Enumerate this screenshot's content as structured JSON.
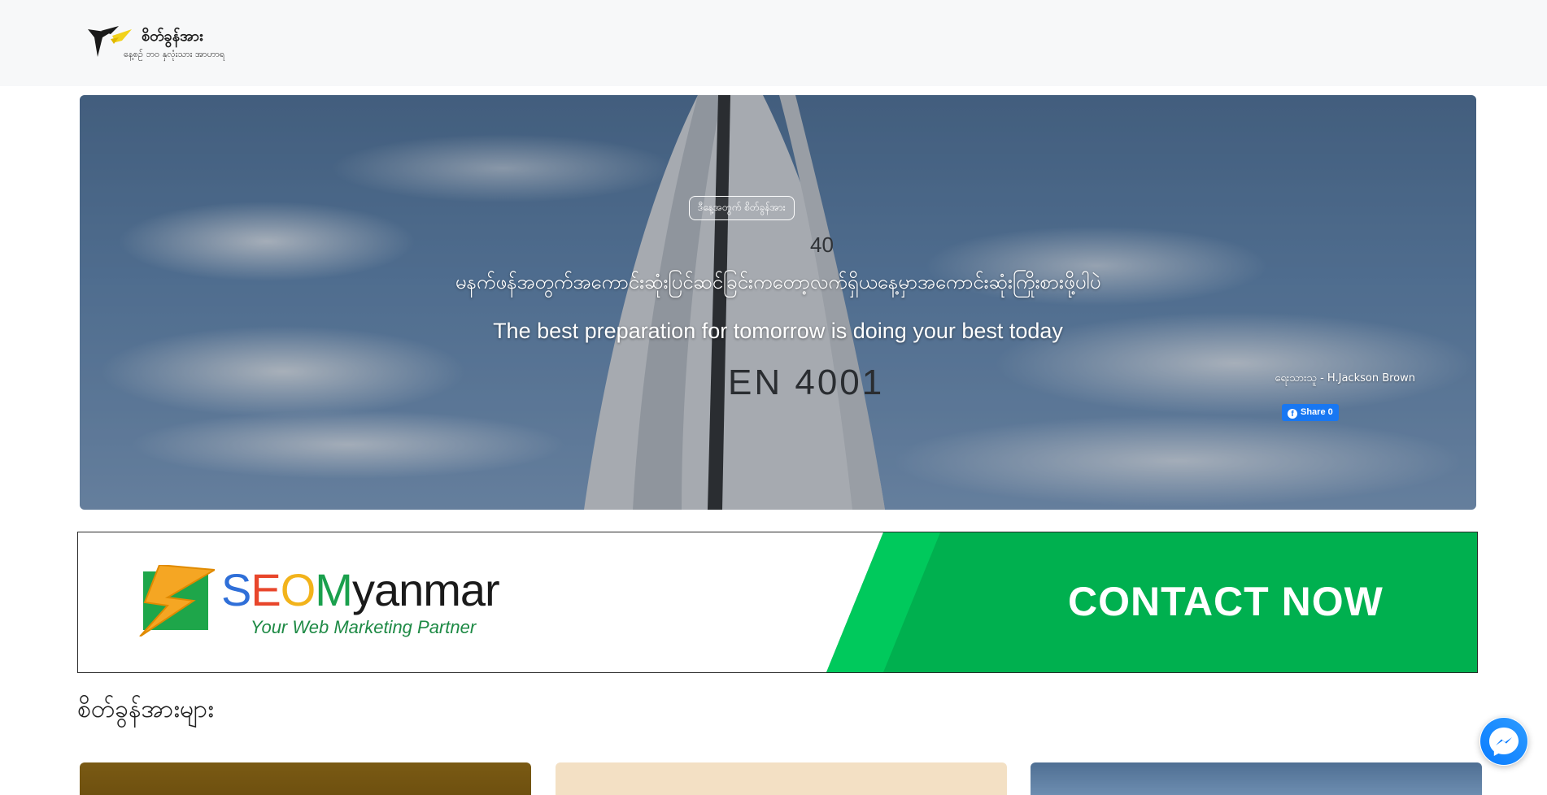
{
  "header": {
    "logo_title": "စိတ်ခွန်အား",
    "logo_subtitle": "နေ့စဉ် ဘဝ နှလုံးသား အာဟာရ"
  },
  "hero": {
    "badge": "ဒီနေ့အတွက် စိတ်ခွန်အား",
    "quote_mm": "မနက်ဖန်အတွက်အကောင်းဆုံးပြင်ဆင်ခြင်းကတော့လက်ရှိယနေ့မှာအကောင်းဆုံးကြိုးစားဖို့ပါပဲ",
    "quote_en": "The best preparation for tomorrow is doing your best today",
    "author": "ရေးသားသူ - H.Jackson Brown",
    "share_label": "Share 0",
    "sail_number": "EN 4001",
    "sail_mark": "40"
  },
  "banner": {
    "brand_s": "S",
    "brand_e": "E",
    "brand_o": "O",
    "brand_m": "M",
    "brand_rest": "yanmar",
    "tagline": "Your Web Marketing Partner",
    "cta": "CONTACT NOW",
    "colors": {
      "green": "#00b04f",
      "light_green": "#00c25a"
    }
  },
  "section": {
    "title": "စိတ်ခွန်အားများ"
  },
  "icons": {
    "logo": "bird-logo-icon",
    "facebook": "facebook-icon",
    "messenger": "messenger-icon",
    "seo": "seo-lightning-logo-icon"
  }
}
